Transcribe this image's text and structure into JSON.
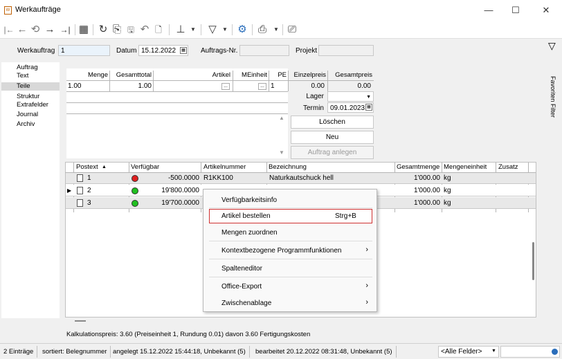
{
  "window": {
    "title": "Werkaufträge",
    "minimize": "—",
    "maximize": "☐",
    "close": "✕"
  },
  "toolbar": {
    "first": "|←",
    "prev": "←",
    "history": "⟲",
    "next": "→",
    "last": "→|",
    "table": "▦",
    "refresh": "↻",
    "new": "⎘",
    "save": "🖫",
    "undo": "↶",
    "delete": "🗋",
    "pin": "⊥",
    "filter": "▽",
    "settings": "⚙",
    "print": "⎙",
    "export": "⎚"
  },
  "header": {
    "werkauftrag_label": "Werkauftrag",
    "werkauftrag_value": "1",
    "datum_label": "Datum",
    "datum_value": "15.12.2022",
    "auftragsnr_label": "Auftrags-Nr.",
    "auftragsnr_value": "",
    "projekt_label": "Projekt",
    "projekt_value": ""
  },
  "nav": {
    "items": [
      "Auftrag",
      "Text",
      "Teile",
      "Struktur",
      "Extrafelder",
      "Journal",
      "Archiv"
    ],
    "selected": "Teile"
  },
  "sidepanel": {
    "label": "Favoriten Filter"
  },
  "form": {
    "headers": {
      "menge": "Menge",
      "gesamttotal": "Gesamttotal",
      "artikel": "Artikel",
      "meinheit": "MEinheit",
      "pe": "PE",
      "einzelpreis": "Einzelpreis",
      "gesamtpreis": "Gesamtpreis"
    },
    "values": {
      "menge": "1.00",
      "gesamttotal": "1.00",
      "artikel_btn": "...",
      "meinheit_btn": "...",
      "pe": "1",
      "einzelpreis": "0.00",
      "gesamtpreis": "0.00"
    },
    "lager_label": "Lager",
    "termin_label": "Termin",
    "termin_value": "09.01.2023",
    "loeschen": "Löschen",
    "neu": "Neu",
    "auftrag_anlegen": "Auftrag anlegen"
  },
  "grid": {
    "columns": [
      "Postext",
      "Verfügbar",
      "Artikelnummer",
      "Bezeichnung",
      "Gesamtmenge",
      "Mengeneinheit",
      "Zusatz"
    ],
    "sort_indicator": "▲",
    "rows": [
      {
        "postext": "1",
        "status_color": "#e02020",
        "verfuegbar": "-500.0000",
        "artikelnummer": "R1KK100",
        "bezeichnung": "Naturkautschuck hell",
        "gesamtmenge": "1'000.00",
        "einheit": "kg"
      },
      {
        "postext": "2",
        "status_color": "#20c020",
        "verfuegbar": "19'800.0000",
        "artikelnummer": "",
        "bezeichnung": "",
        "gesamtmenge": "1'000.00",
        "einheit": "kg"
      },
      {
        "postext": "3",
        "status_color": "#20c020",
        "verfuegbar": "19'700.0000",
        "artikelnummer": "",
        "bezeichnung": "",
        "gesamtmenge": "1'000.00",
        "einheit": "kg"
      }
    ],
    "current_row_marker": "▶"
  },
  "context_menu": {
    "items": [
      "Verfügbarkeitsinfo",
      "Artikel bestellen",
      "Mengen zuordnen",
      "Kontextbezogene Programmfunktionen",
      "Spalteneditor",
      "Office-Export",
      "Zwischenablage"
    ],
    "shortcut": "Strg+B",
    "submenu_arrow": "›",
    "highlight_color": "#d03030"
  },
  "footer_info": "Kalkulationspreis: 3.60 (Preiseinheit 1, Rundung 0.01)  davon 3.60 Fertigungskosten",
  "status": {
    "count": "2 Einträge",
    "sort": "sortiert: Belegnummer",
    "created": "angelegt 15.12.2022 15:44:18, Unbekannt (5)",
    "edited": "bearbeitet 20.12.2022 08:31:48, Unbekannt (5)",
    "field_filter": "<Alle Felder>"
  }
}
